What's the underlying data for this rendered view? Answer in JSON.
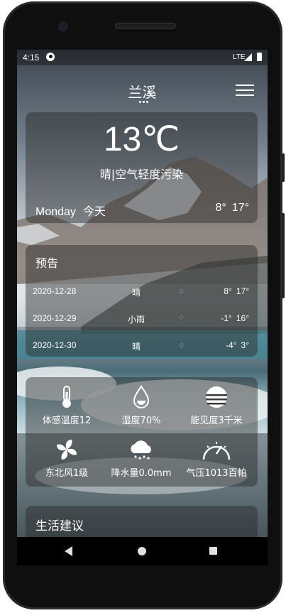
{
  "status_bar": {
    "time": "4:15",
    "network": "LTE"
  },
  "header": {
    "city": "兰溪"
  },
  "current": {
    "temperature": "13℃",
    "condition": "晴|空气轻度污染",
    "day": "Monday",
    "today": "今天",
    "low": "8°",
    "high": "17°"
  },
  "forecast": {
    "title": "预告",
    "rows": [
      {
        "date": "2020-12-28",
        "weather": "晴",
        "low": "8°",
        "high": "17°"
      },
      {
        "date": "2020-12-29",
        "weather": "小雨",
        "low": "-1°",
        "high": "16°"
      },
      {
        "date": "2020-12-30",
        "weather": "晴",
        "low": "-4°",
        "high": "3°"
      }
    ]
  },
  "indicators": [
    {
      "label": "体感温度12",
      "icon": "thermometer-icon"
    },
    {
      "label": "湿度70%",
      "icon": "droplet-icon"
    },
    {
      "label": "能见度3千米",
      "icon": "sun-haze-icon"
    },
    {
      "label": "东北风1级",
      "icon": "fan-icon"
    },
    {
      "label": "降水量0.0mm",
      "icon": "rain-cloud-icon"
    },
    {
      "label": "气压1013百帕",
      "icon": "gauge-icon"
    }
  ],
  "life": {
    "title": "生活建议"
  },
  "colors": {
    "card_bg": "rgba(40,40,40,0.45)",
    "text": "#ffffff"
  }
}
